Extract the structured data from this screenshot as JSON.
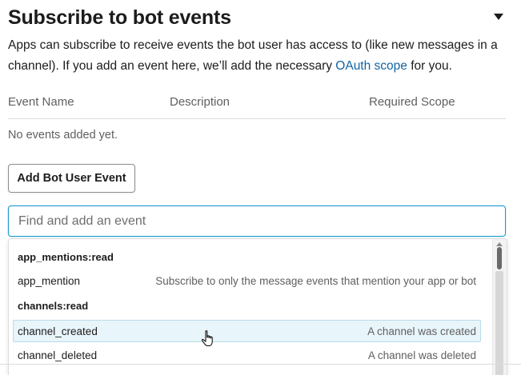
{
  "section": {
    "title": "Subscribe to bot events",
    "description_pre": "Apps can subscribe to receive events the bot user has access to (like new messages in a channel). If you add an event here, we’ll add the necessary ",
    "description_link": "OAuth scope",
    "description_post": " for you.",
    "toggle_icon": "caret-down-icon"
  },
  "table": {
    "headers": [
      "Event Name",
      "Description",
      "Required Scope"
    ],
    "empty_message": "No events added yet."
  },
  "add_button_label": "Add Bot User Event",
  "search": {
    "placeholder": "Find and add an event",
    "value": ""
  },
  "dropdown": {
    "groups": [
      {
        "scope": "app_mentions:read",
        "events": [
          {
            "name": "app_mention",
            "description": "Subscribe to only the message events that mention your app or bot",
            "highlighted": false
          }
        ]
      },
      {
        "scope": "channels:read",
        "events": [
          {
            "name": "channel_created",
            "description": "A channel was created",
            "highlighted": true
          },
          {
            "name": "channel_deleted",
            "description": "A channel was deleted",
            "highlighted": false
          }
        ]
      }
    ]
  },
  "colors": {
    "link": "#1264a3",
    "focus_border": "#1d9bd1",
    "highlight_bg": "#e8f5fa",
    "muted_text": "#616061"
  },
  "cursor_icon": "hand-pointer-icon"
}
